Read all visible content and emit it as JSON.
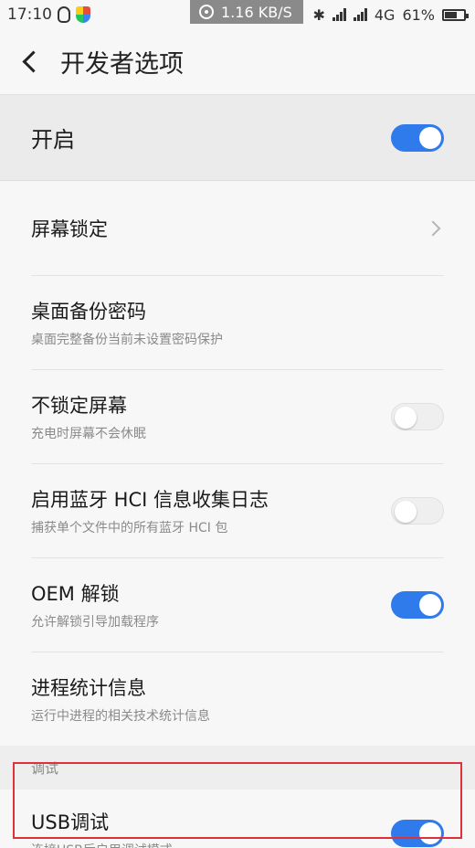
{
  "status_bar": {
    "time": "17:10",
    "net_speed": "1.16 KB/S",
    "network_type": "4G",
    "battery": "61%"
  },
  "header": {
    "title": "开发者选项"
  },
  "master": {
    "label": "开启",
    "enabled": true
  },
  "items": [
    {
      "title": "屏幕锁定",
      "subtitle": "",
      "control": "chevron"
    },
    {
      "title": "桌面备份密码",
      "subtitle": "桌面完整备份当前未设置密码保护",
      "control": "none"
    },
    {
      "title": "不锁定屏幕",
      "subtitle": "充电时屏幕不会休眠",
      "control": "switch",
      "on": false
    },
    {
      "title": "启用蓝牙 HCI 信息收集日志",
      "subtitle": "捕获单个文件中的所有蓝牙 HCI 包",
      "control": "switch",
      "on": false
    },
    {
      "title": "OEM 解锁",
      "subtitle": "允许解锁引导加载程序",
      "control": "switch",
      "on": true
    },
    {
      "title": "进程统计信息",
      "subtitle": "运行中进程的相关技术统计信息",
      "control": "none"
    }
  ],
  "debug_section": {
    "header": "调试",
    "usb": {
      "title": "USB调试",
      "subtitle": "连接USB后启用调试模式",
      "on": true
    }
  },
  "colors": {
    "accent": "#2f7bec",
    "highlight": "#e0303a"
  }
}
